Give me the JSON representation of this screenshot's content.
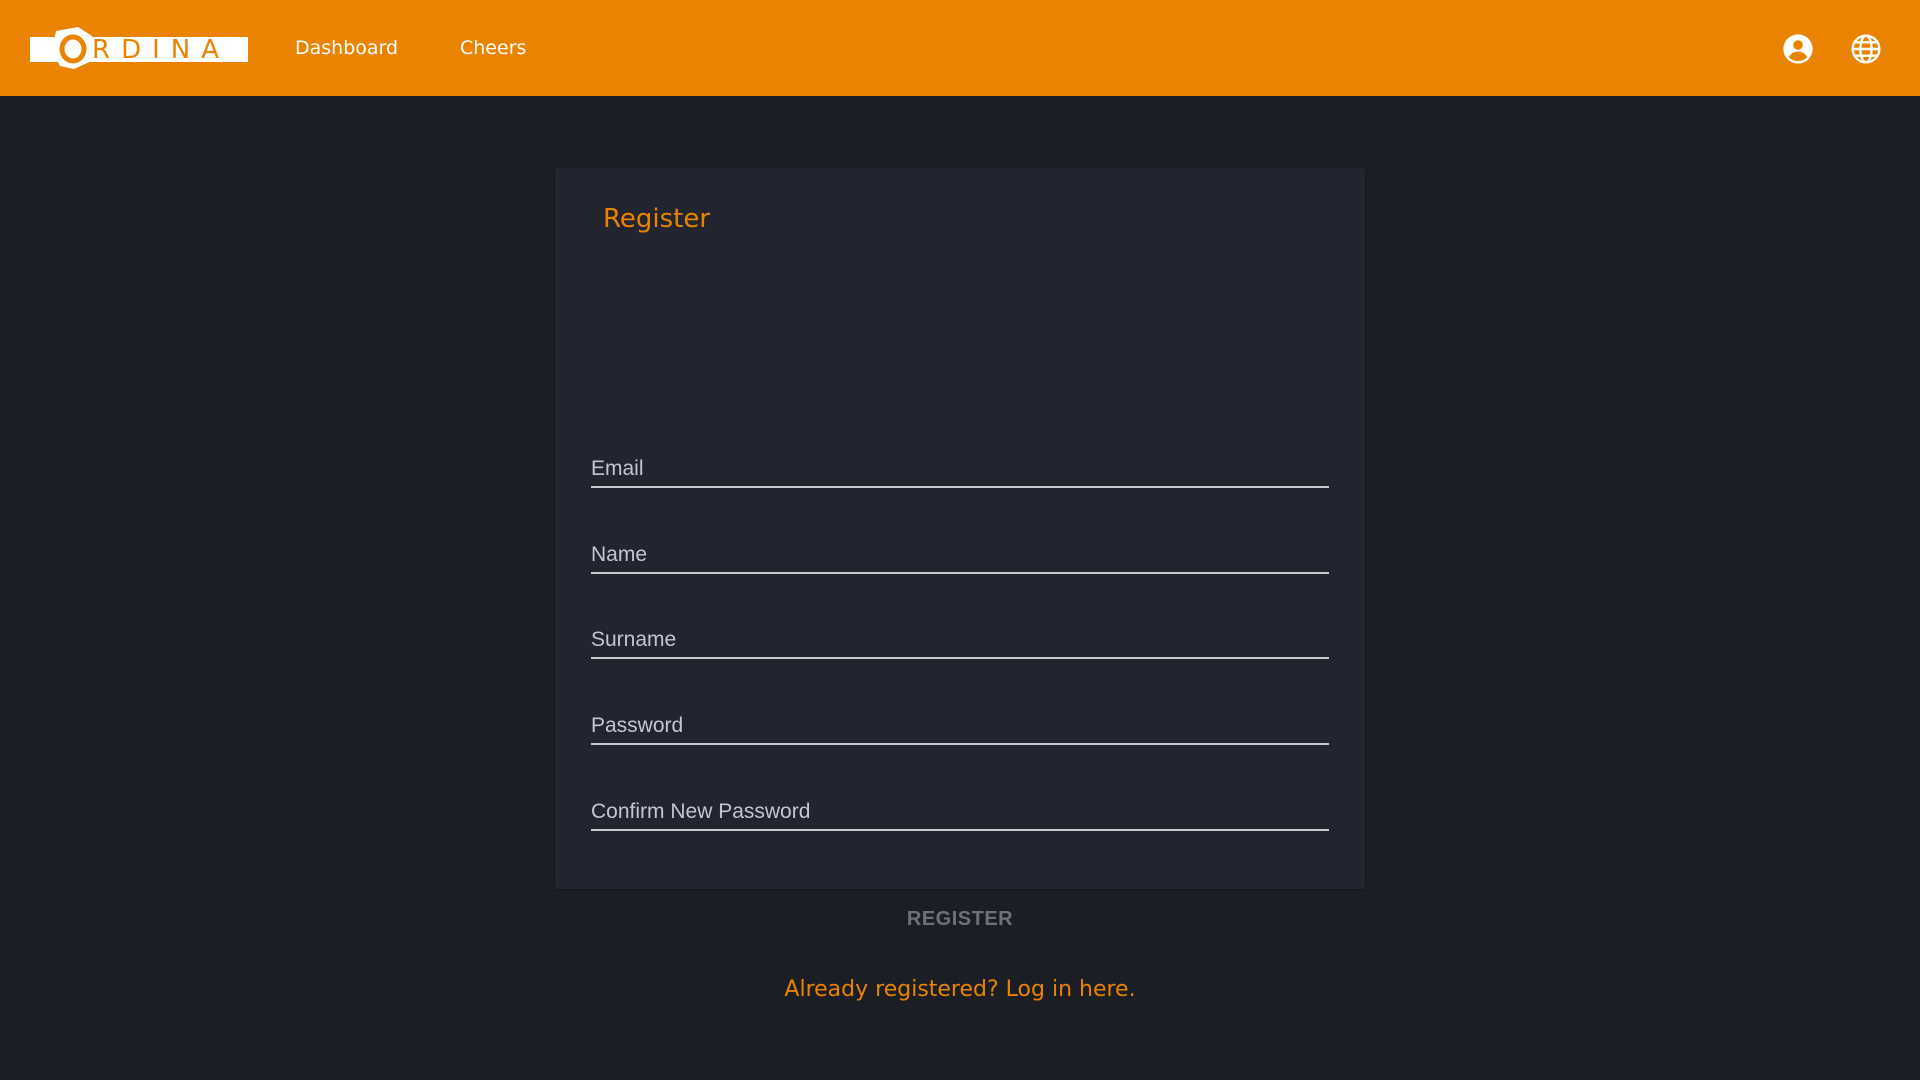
{
  "colors": {
    "brand_orange": "#ea8400",
    "background": "#1c1e26",
    "card": "#22252f"
  },
  "header": {
    "logo_text": "ORDINA",
    "nav": [
      {
        "label": "Dashboard"
      },
      {
        "label": "Cheers"
      }
    ],
    "icons": {
      "account": "account-circle-icon",
      "language": "globe-icon"
    }
  },
  "register_form": {
    "title": "Register",
    "fields": [
      {
        "placeholder": "Email",
        "value": ""
      },
      {
        "placeholder": "Name",
        "value": ""
      },
      {
        "placeholder": "Surname",
        "value": ""
      },
      {
        "placeholder": "Password",
        "value": ""
      },
      {
        "placeholder": "Confirm New Password",
        "value": ""
      }
    ],
    "submit_label": "REGISTER",
    "login_link": "Already registered? Log in here."
  }
}
